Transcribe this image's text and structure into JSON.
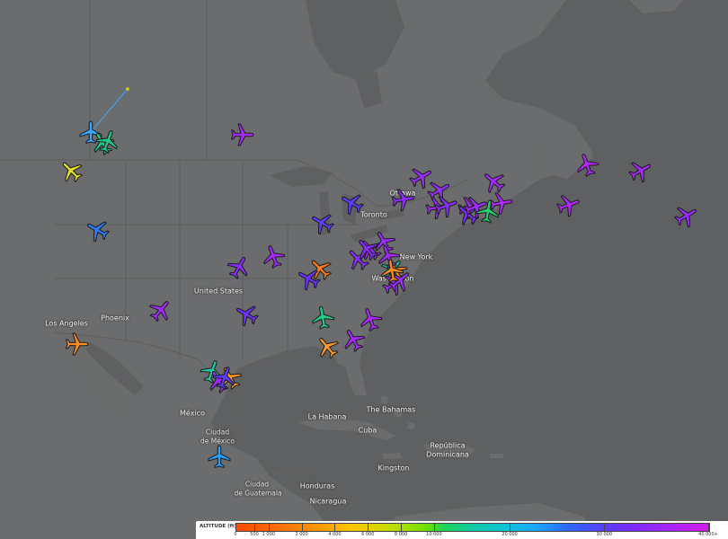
{
  "map": {
    "place_labels": [
      {
        "id": "toronto",
        "text": "Toronto"
      },
      {
        "id": "ottawa",
        "text": "Ottawa"
      },
      {
        "id": "new-york",
        "text": "New York"
      },
      {
        "id": "washington",
        "text": "Washington"
      },
      {
        "id": "united-states",
        "text": "United States"
      },
      {
        "id": "los-angeles",
        "text": "Los Angeles"
      },
      {
        "id": "phoenix",
        "text": "Phoenix"
      },
      {
        "id": "mexico",
        "text": "México"
      },
      {
        "id": "ciudad-de-mexico-1",
        "text": "Ciudad"
      },
      {
        "id": "ciudad-de-mexico-2",
        "text": "de México"
      },
      {
        "id": "la-habana",
        "text": "La Habana"
      },
      {
        "id": "the-bahamas",
        "text": "The Bahamas"
      },
      {
        "id": "cuba",
        "text": "Cuba"
      },
      {
        "id": "republica-1",
        "text": "República"
      },
      {
        "id": "republica-2",
        "text": "Dominicana"
      },
      {
        "id": "kingston",
        "text": "Kingston"
      },
      {
        "id": "honduras",
        "text": "Honduras"
      },
      {
        "id": "nicaragua",
        "text": "Nicaragua"
      },
      {
        "id": "guatemala-1",
        "text": "Ciudad"
      },
      {
        "id": "guatemala-2",
        "text": "de Guatemala"
      }
    ]
  },
  "legend": {
    "title": "ALTITUDE (ft)",
    "ticks": [
      "0",
      "500",
      "1 000",
      "2 000",
      "4 000",
      "6 000",
      "8 000",
      "10 000",
      "20 000",
      "30 000",
      "40 000+"
    ]
  },
  "colors": {
    "land": "#6b6c6d",
    "water": "#5f6061",
    "border": "#5a5b5c",
    "aircraft_outline": "#1f1f1f"
  },
  "aircraft": [
    {
      "id": "ac1",
      "color": "#3aa6ff"
    },
    {
      "id": "ac2",
      "color": "#1fc98a"
    },
    {
      "id": "ac3",
      "color": "#e6e02a"
    },
    {
      "id": "ac4",
      "color": "#a528ff"
    },
    {
      "id": "ac5",
      "color": "#2b7bff"
    },
    {
      "id": "ac6",
      "color": "#9b2cff"
    },
    {
      "id": "ac7",
      "color": "#9b2cff"
    },
    {
      "id": "ac8",
      "color": "#8d2cff"
    },
    {
      "id": "ac9",
      "color": "#5a3dff"
    },
    {
      "id": "ac10",
      "color": "#a528ff"
    },
    {
      "id": "ac11",
      "color": "#a528ff"
    },
    {
      "id": "ac12",
      "color": "#b028ff"
    },
    {
      "id": "ac13",
      "color": "#ff7a1a"
    },
    {
      "id": "ac14",
      "color": "#1fc9a0"
    },
    {
      "id": "ac15",
      "color": "#ff8a20"
    },
    {
      "id": "ac16",
      "color": "#25c7a0"
    },
    {
      "id": "ac17",
      "color": "#ff9a2a"
    },
    {
      "id": "ac18",
      "color": "#2aa0ff"
    },
    {
      "id": "ac19",
      "color": "#6b32ff"
    },
    {
      "id": "ac20",
      "color": "#a528ff"
    },
    {
      "id": "ac21",
      "color": "#8a2cff"
    },
    {
      "id": "ac22",
      "color": "#6b32ff"
    },
    {
      "id": "ac23",
      "color": "#ff8a20"
    },
    {
      "id": "ac24",
      "color": "#a528ff"
    },
    {
      "id": "ac25",
      "color": "#b028ff"
    },
    {
      "id": "ac26",
      "color": "#1fcf8a"
    },
    {
      "id": "ac27",
      "color": "#ff9a2a"
    },
    {
      "id": "ac28",
      "color": "#a528ff"
    },
    {
      "id": "ac29",
      "color": "#8a2cff"
    },
    {
      "id": "ac30",
      "color": "#a528ff"
    },
    {
      "id": "ac31",
      "color": "#9b2cff"
    },
    {
      "id": "ac32",
      "color": "#5a3dff"
    },
    {
      "id": "ac33",
      "color": "#a528ff"
    },
    {
      "id": "ac34",
      "color": "#b028ff"
    },
    {
      "id": "ac35",
      "color": "#a528ff"
    },
    {
      "id": "ac36",
      "color": "#b028ff"
    },
    {
      "id": "ac37",
      "color": "#9b2cff"
    },
    {
      "id": "ac38",
      "color": "#a528ff"
    },
    {
      "id": "ac39",
      "color": "#7a2cff"
    },
    {
      "id": "ac40",
      "color": "#a528ff"
    },
    {
      "id": "ac41",
      "color": "#1fd36a"
    },
    {
      "id": "ac42",
      "color": "#8a2cff"
    },
    {
      "id": "ac43",
      "color": "#a528ff"
    },
    {
      "id": "ac44",
      "color": "#5a3dff"
    },
    {
      "id": "ac45",
      "color": "#8a2cff"
    },
    {
      "id": "ac46",
      "color": "#a528ff"
    },
    {
      "id": "ac47",
      "color": "#9b2cff"
    },
    {
      "id": "ac48",
      "color": "#ff8a20"
    },
    {
      "id": "ac49",
      "color": "#1fc98a"
    }
  ]
}
